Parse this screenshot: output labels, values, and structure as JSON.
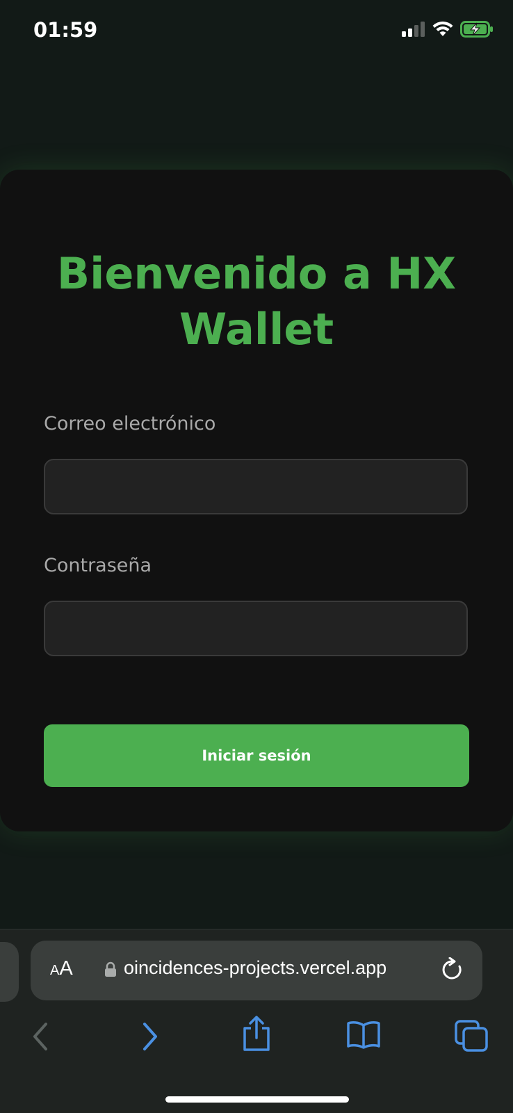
{
  "status": {
    "time": "01:59"
  },
  "login": {
    "title": "Bienvenido a HX Wallet",
    "email_label": "Correo electrónico",
    "email_value": "",
    "password_label": "Contraseña",
    "password_value": "",
    "submit_label": "Iniciar sesión"
  },
  "browser": {
    "text_size_label": "AA",
    "url": "oincidences-projects.vercel.app"
  },
  "colors": {
    "accent": "#4caf50",
    "card": "#111111",
    "input": "#222222",
    "ios_blue": "#4a90e2"
  },
  "icons": [
    "signal-icon",
    "wifi-icon",
    "battery-icon",
    "lock-icon",
    "reload-icon",
    "back-icon",
    "forward-icon",
    "share-icon",
    "bookmarks-icon",
    "tabs-icon"
  ]
}
